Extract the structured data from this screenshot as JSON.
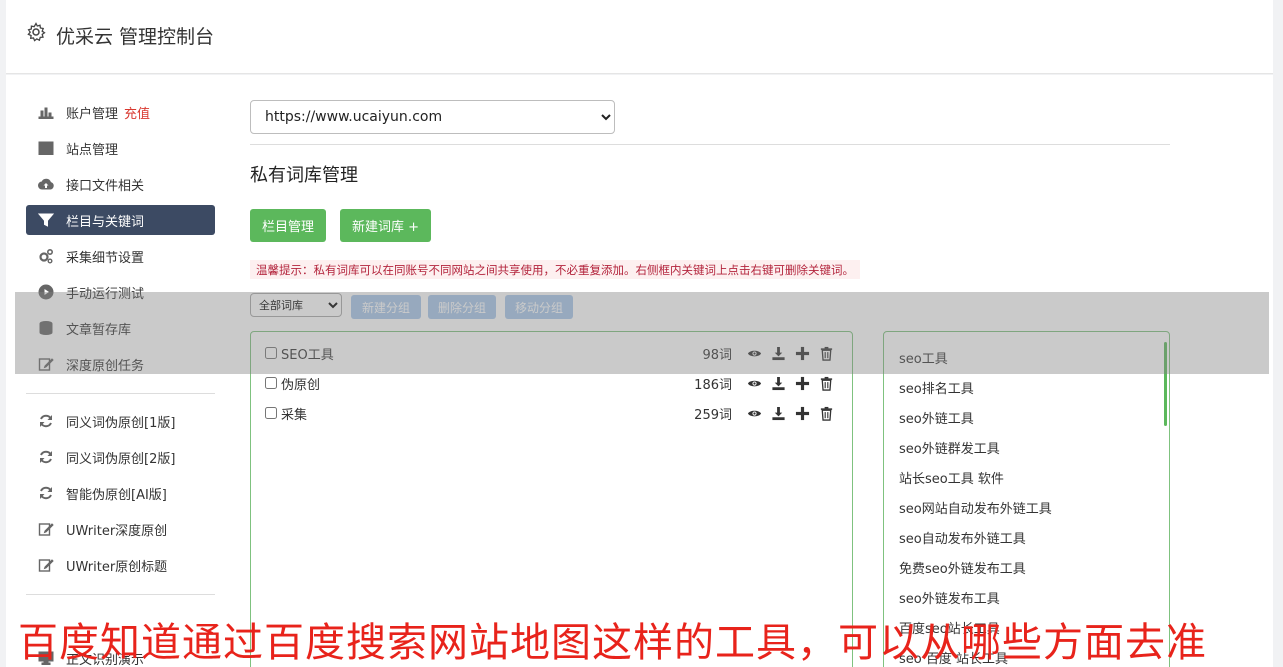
{
  "header": {
    "title": "优采云 管理控制台"
  },
  "sidebar": {
    "items": [
      {
        "label": "账户管理",
        "icon": "bar-chart-icon",
        "extra": "充值"
      },
      {
        "label": "站点管理",
        "icon": "server-icon"
      },
      {
        "label": "接口文件相关",
        "icon": "cloud-upload-icon"
      },
      {
        "label": "栏目与关键词",
        "icon": "filter-icon",
        "active": true
      },
      {
        "label": "采集细节设置",
        "icon": "cogs-icon"
      },
      {
        "label": "手动运行测试",
        "icon": "play-circle-icon"
      },
      {
        "label": "文章暂存库",
        "icon": "database-icon"
      },
      {
        "label": "深度原创任务",
        "icon": "edit-icon"
      },
      {
        "label": "同义词伪原创[1版]",
        "icon": "refresh-icon"
      },
      {
        "label": "同义词伪原创[2版]",
        "icon": "refresh-icon"
      },
      {
        "label": "智能伪原创[AI版]",
        "icon": "refresh-icon"
      },
      {
        "label": "UWriter深度原创",
        "icon": "edit-icon"
      },
      {
        "label": "UWriter原创标题",
        "icon": "edit-icon"
      },
      {
        "label": "正文识别演示",
        "icon": "desktop-icon"
      }
    ]
  },
  "main": {
    "site_select": {
      "value": "https://www.ucaiyun.com"
    },
    "title": "私有词库管理",
    "buttons": {
      "column_manage": "栏目管理",
      "new_library": "新建词库 +"
    },
    "tip": "温馨提示：私有词库可以在同账号不同网站之间共享使用，不必重复添加。右侧框内关键词上点击右键可删除关键词。",
    "library_select": {
      "value": "全部词库"
    },
    "group_buttons": {
      "new_group": "新建分组",
      "delete_group": "删除分组",
      "move_group": "移动分组"
    },
    "groups": [
      {
        "name": "SEO工具",
        "count": "98词"
      },
      {
        "name": "伪原创",
        "count": "186词"
      },
      {
        "name": "采集",
        "count": "259词"
      }
    ],
    "keywords": [
      "seo工具",
      "seo排名工具",
      "seo外链工具",
      "seo外链群发工具",
      "站长seo工具 软件",
      "seo网站自动发布外链工具",
      "seo自动发布外链工具",
      "免费seo外链发布工具",
      "seo外链发布工具",
      "百度seo站长工具",
      "seo 百度 站长工具"
    ]
  },
  "caption": "百度知道通过百度搜索网站地图这样的工具，可以从哪些方面去准",
  "colors": {
    "accent_green": "#5cb85c",
    "active_nav": "#3c4a63",
    "recharge_red": "#d9382f",
    "caption_red": "#e8231b"
  }
}
